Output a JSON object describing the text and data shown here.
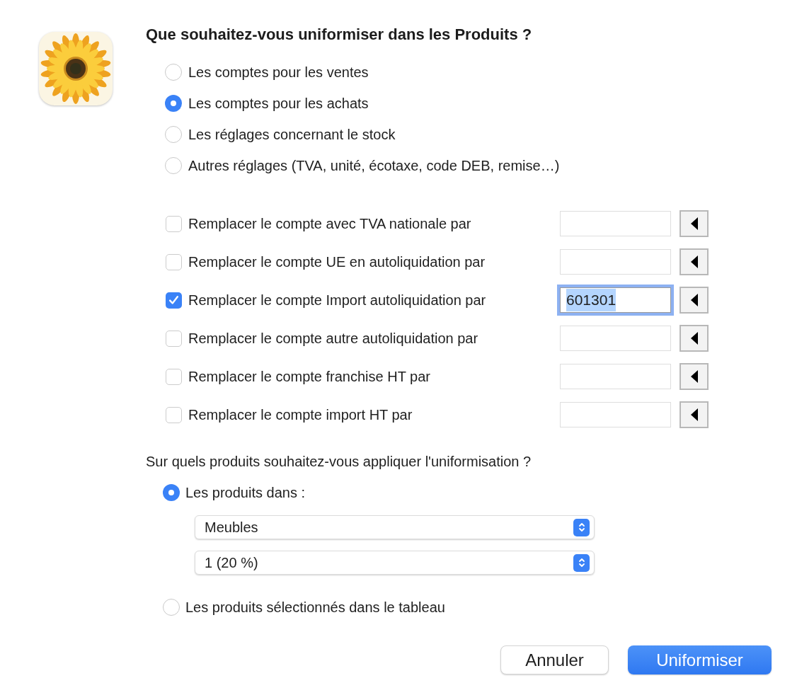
{
  "title": "Que souhaitez-vous uniformiser dans les Produits ?",
  "field_options": [
    {
      "label": "Les comptes pour les ventes",
      "selected": false
    },
    {
      "label": "Les comptes pour les achats",
      "selected": true
    },
    {
      "label": "Les réglages concernant le stock",
      "selected": false
    },
    {
      "label": "Autres réglages (TVA, unité, écotaxe, code DEB, remise…)",
      "selected": false
    }
  ],
  "replacements": [
    {
      "label": "Remplacer le compte avec TVA nationale par",
      "checked": false,
      "focused": false
    },
    {
      "label": "Remplacer le compte UE en autoliquidation par",
      "checked": false,
      "focused": false
    },
    {
      "label": "Remplacer le compte Import autoliquidation par",
      "checked": true,
      "focused": true,
      "value": "601301"
    },
    {
      "label": "Remplacer le compte autre autoliquidation par",
      "checked": false,
      "focused": false
    },
    {
      "label": "Remplacer le compte franchise HT par",
      "checked": false,
      "focused": false
    },
    {
      "label": "Remplacer le compte import HT par",
      "checked": false,
      "focused": false
    }
  ],
  "scope": {
    "question": "Sur quels produits souhaitez-vous appliquer l'uniformisation ?",
    "options": [
      {
        "label": "Les produits dans :",
        "selected": true,
        "filters": [
          "Meubles",
          "1 (20 %)"
        ]
      },
      {
        "label": "Les produits sélectionnés dans le tableau",
        "selected": false
      }
    ]
  },
  "buttons": [
    {
      "label": "Annuler",
      "kind": "secondary"
    },
    {
      "label": "Uniformiser",
      "kind": "primary"
    }
  ]
}
